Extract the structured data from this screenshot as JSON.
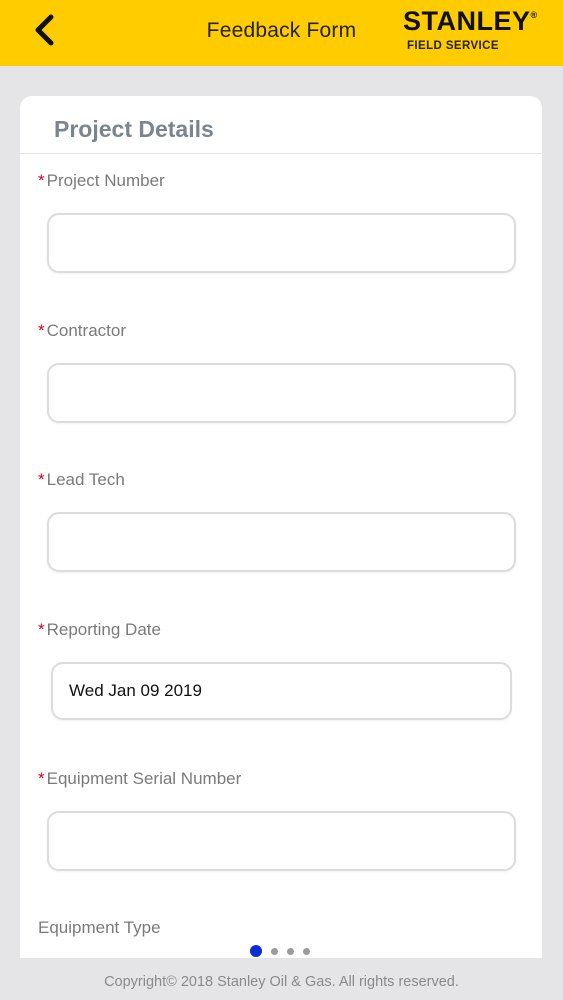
{
  "header": {
    "back_icon": "chevron-left-icon",
    "title": "Feedback Form",
    "brand_name": "STANLEY",
    "brand_mark": "®",
    "brand_sub": "FIELD SERVICE",
    "background_color": "#ffcc00"
  },
  "form": {
    "section_title": "Project Details",
    "required_marker": "*",
    "fields": [
      {
        "label": "Project Number",
        "required": true,
        "value": "",
        "placeholder": ""
      },
      {
        "label": "Contractor",
        "required": true,
        "value": "",
        "placeholder": ""
      },
      {
        "label": "Lead Tech",
        "required": true,
        "value": "",
        "placeholder": ""
      },
      {
        "label": "Reporting Date",
        "required": true,
        "value": "Wed Jan 09 2019",
        "placeholder": ""
      },
      {
        "label": "Equipment Serial Number",
        "required": true,
        "value": "",
        "placeholder": ""
      },
      {
        "label": "Equipment Type",
        "required": false
      }
    ]
  },
  "pager": {
    "pages": 4,
    "current": 1,
    "active_color": "#0a2dd6"
  },
  "footer": {
    "text": "Copyright© 2018 Stanley Oil & Gas. All rights reserved."
  }
}
